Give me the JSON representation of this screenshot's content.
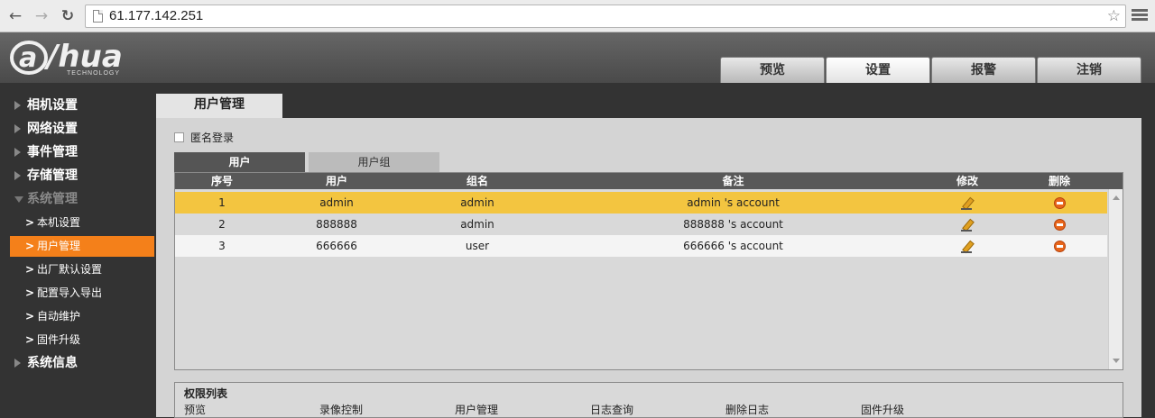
{
  "browser": {
    "url": "61.177.142.251",
    "back_icon": "back-arrow-icon",
    "forward_icon": "forward-arrow-icon",
    "reload_icon": "reload-icon",
    "star_icon": "star-icon"
  },
  "header": {
    "logo_text": "a hua",
    "logo_sub": "TECHNOLOGY",
    "tabs": [
      {
        "label": "预览"
      },
      {
        "label": "设置",
        "active": true
      },
      {
        "label": "报警"
      },
      {
        "label": "注销"
      }
    ]
  },
  "sidebar": {
    "items": [
      {
        "label": "相机设置"
      },
      {
        "label": "网络设置"
      },
      {
        "label": "事件管理"
      },
      {
        "label": "存储管理"
      },
      {
        "label": "系统管理",
        "expanded": true
      },
      {
        "label": "系统信息"
      }
    ],
    "subitems": [
      {
        "label": "本机设置"
      },
      {
        "label": "用户管理",
        "active": true
      },
      {
        "label": "出厂默认设置"
      },
      {
        "label": "配置导入导出"
      },
      {
        "label": "自动维护"
      },
      {
        "label": "固件升级"
      }
    ]
  },
  "main": {
    "panel_title": "用户管理",
    "anonymous_login": "匿名登录",
    "tabs": [
      {
        "label": "用户",
        "active": true
      },
      {
        "label": "用户组"
      }
    ],
    "table": {
      "headers": {
        "no": "序号",
        "user": "用户",
        "group": "组名",
        "note": "备注",
        "edit": "修改",
        "delete": "删除"
      },
      "rows": [
        {
          "no": "1",
          "user": "admin",
          "group": "admin",
          "note": "admin 's account"
        },
        {
          "no": "2",
          "user": "888888",
          "group": "admin",
          "note": "888888 's account"
        },
        {
          "no": "3",
          "user": "666666",
          "group": "user",
          "note": "666666 's account"
        }
      ]
    },
    "permissions": {
      "title": "权限列表",
      "items": [
        "预览",
        "录像控制",
        "用户管理",
        "日志查询",
        "删除日志",
        "固件升级"
      ]
    }
  },
  "colors": {
    "accent": "#f4801a",
    "selected_row": "#f3c540",
    "sidebar_bg": "#333333"
  }
}
